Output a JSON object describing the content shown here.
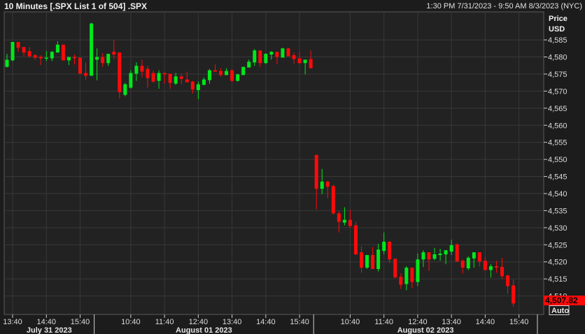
{
  "header": {
    "title": "10 Minutes [.SPX List 1 of 504] .SPX",
    "range": "1:30 PM 7/31/2023 - 9:50 AM 8/3/2023 (NYC)"
  },
  "colors": {
    "up": "#00e81a",
    "down": "#ff0a0a",
    "grid": "#383838",
    "background": "#222222"
  },
  "chart_data": {
    "type": "candlestick",
    "title": "10 Minutes [.SPX List 1 of 504] .SPX",
    "ylabel": "Price",
    "yunit": "USD",
    "ylim": [
      4504.6,
      4593.2
    ],
    "yticks": [
      4510,
      4515,
      4520,
      4525,
      4530,
      4535,
      4540,
      4545,
      4550,
      4555,
      4560,
      4565,
      4570,
      4575,
      4580,
      4585
    ],
    "ytick_labels": [
      "4,510",
      "4,515",
      "4,520",
      "4,525",
      "4,530",
      "4,535",
      "4,540",
      "4,545",
      "4,550",
      "4,555",
      "4,560",
      "4,565",
      "4,570",
      "4,575",
      "4,580",
      "4,585"
    ],
    "last_price_label": "4,507.82",
    "auto_label": "Auto",
    "xticks": [
      {
        "i": 2,
        "label": "13:40"
      },
      {
        "i": 8,
        "label": "14:40"
      },
      {
        "i": 14,
        "label": "15:40"
      },
      {
        "i": 23,
        "label": "10:40"
      },
      {
        "i": 29,
        "label": "11:40"
      },
      {
        "i": 35,
        "label": "12:40"
      },
      {
        "i": 41,
        "label": "13:40"
      },
      {
        "i": 47,
        "label": "14:40"
      },
      {
        "i": 53,
        "label": "15:40"
      },
      {
        "i": 62,
        "label": "10:40"
      },
      {
        "i": 68,
        "label": "11:40"
      },
      {
        "i": 74,
        "label": "12:40"
      },
      {
        "i": 80,
        "label": "13:40"
      },
      {
        "i": 86,
        "label": "14:40"
      },
      {
        "i": 92,
        "label": "15:40"
      }
    ],
    "days": [
      {
        "label": "July 31 2023",
        "from": 1,
        "to": 16
      },
      {
        "label": "August 01 2023",
        "from": 17,
        "to": 55
      },
      {
        "label": "August 02 2023",
        "from": 56,
        "to": 95
      }
    ],
    "grid": true,
    "ohlc": [
      [
        4577.1,
        4580.9,
        4576.9,
        4579.2
      ],
      [
        4579.0,
        4584.4,
        4578.8,
        4584.4
      ],
      [
        4584.4,
        4584.4,
        4581.5,
        4582.7
      ],
      [
        4582.9,
        4582.9,
        4580.2,
        4581.3
      ],
      [
        4581.7,
        4582.9,
        4579.8,
        4580.2
      ],
      [
        4580.5,
        4580.9,
        4579.2,
        4579.8
      ],
      [
        4580.0,
        4580.5,
        4577.6,
        4579.6
      ],
      [
        4579.6,
        4581.7,
        4578.8,
        4579.8
      ],
      [
        4579.6,
        4581.7,
        4578.8,
        4581.5
      ],
      [
        4581.3,
        4584.6,
        4581.3,
        4583.6
      ],
      [
        4583.6,
        4583.6,
        4579.0,
        4579.0
      ],
      [
        4579.0,
        4580.0,
        4577.6,
        4580.0
      ],
      [
        4580.0,
        4580.7,
        4577.8,
        4579.6
      ],
      [
        4579.8,
        4579.8,
        4575.1,
        4575.1
      ],
      [
        4575.3,
        4578.4,
        4573.2,
        4574.5
      ],
      [
        4574.5,
        4590.0,
        4574.5,
        4589.8
      ],
      [
        4579.2,
        4582.5,
        4573.2,
        4580.0
      ],
      [
        4580.0,
        4581.1,
        4577.1,
        4578.2
      ],
      [
        4578.2,
        4580.9,
        4577.4,
        4580.9
      ],
      [
        4581.5,
        4585.0,
        4579.4,
        4580.7
      ],
      [
        4581.3,
        4581.3,
        4567.9,
        4569.7
      ],
      [
        4568.9,
        4572.4,
        4568.5,
        4572.0
      ],
      [
        4571.0,
        4576.1,
        4570.7,
        4575.3
      ],
      [
        4575.1,
        4578.4,
        4573.0,
        4577.4
      ],
      [
        4577.4,
        4579.2,
        4574.0,
        4575.7
      ],
      [
        4576.5,
        4577.4,
        4571.0,
        4573.8
      ],
      [
        4575.3,
        4576.1,
        4572.4,
        4572.8
      ],
      [
        4573.0,
        4576.1,
        4570.7,
        4575.3
      ],
      [
        4575.3,
        4575.3,
        4572.2,
        4574.9
      ],
      [
        4575.1,
        4575.1,
        4570.7,
        4572.4
      ],
      [
        4572.2,
        4575.3,
        4571.8,
        4574.3
      ],
      [
        4574.3,
        4575.1,
        4572.0,
        4573.6
      ],
      [
        4573.4,
        4575.7,
        4572.6,
        4572.6
      ],
      [
        4572.8,
        4573.0,
        4569.3,
        4570.5
      ],
      [
        4570.3,
        4572.8,
        4567.6,
        4572.0
      ],
      [
        4571.8,
        4574.0,
        4571.8,
        4573.4
      ],
      [
        4573.2,
        4576.5,
        4572.2,
        4576.1
      ],
      [
        4576.1,
        4577.8,
        4575.7,
        4575.7
      ],
      [
        4575.9,
        4576.7,
        4574.3,
        4574.7
      ],
      [
        4574.7,
        4576.7,
        4574.7,
        4575.9
      ],
      [
        4576.1,
        4576.3,
        4572.6,
        4573.0
      ],
      [
        4573.0,
        4575.1,
        4572.8,
        4574.9
      ],
      [
        4574.7,
        4577.1,
        4574.7,
        4577.1
      ],
      [
        4576.9,
        4579.2,
        4576.9,
        4578.6
      ],
      [
        4578.4,
        4582.3,
        4577.4,
        4581.9
      ],
      [
        4581.9,
        4581.9,
        4577.1,
        4578.2
      ],
      [
        4578.2,
        4581.1,
        4578.0,
        4580.9
      ],
      [
        4580.7,
        4581.7,
        4579.2,
        4581.5
      ],
      [
        4581.5,
        4581.5,
        4577.8,
        4580.0
      ],
      [
        4579.8,
        4582.7,
        4579.8,
        4582.5
      ],
      [
        4582.5,
        4582.7,
        4580.2,
        4580.2
      ],
      [
        4580.5,
        4581.3,
        4578.0,
        4579.4
      ],
      [
        4579.6,
        4581.5,
        4577.8,
        4578.2
      ],
      [
        4578.2,
        4579.2,
        4574.9,
        4579.2
      ],
      [
        4579.4,
        4581.9,
        4576.7,
        4576.7
      ],
      [
        4551.3,
        4551.3,
        4535.4,
        4541.4
      ],
      [
        4541.4,
        4547.2,
        4539.8,
        4543.5
      ],
      [
        4543.5,
        4543.7,
        4538.7,
        4542.0
      ],
      [
        4542.2,
        4542.6,
        4533.8,
        4534.2
      ],
      [
        4534.2,
        4534.8,
        4528.6,
        4531.7
      ],
      [
        4531.5,
        4536.0,
        4530.7,
        4532.3
      ],
      [
        4532.3,
        4535.2,
        4530.0,
        4530.5
      ],
      [
        4530.7,
        4531.7,
        4522.0,
        4522.2
      ],
      [
        4522.8,
        4524.5,
        4516.8,
        4518.3
      ],
      [
        4518.3,
        4522.0,
        4517.9,
        4522.0
      ],
      [
        4522.0,
        4524.3,
        4517.9,
        4517.9
      ],
      [
        4517.9,
        4525.3,
        4517.2,
        4523.6
      ],
      [
        4523.2,
        4528.6,
        4522.2,
        4525.9
      ],
      [
        4525.9,
        4526.1,
        4519.7,
        4520.7
      ],
      [
        4520.9,
        4520.9,
        4515.4,
        4515.4
      ],
      [
        4515.6,
        4516.6,
        4512.1,
        4513.3
      ],
      [
        4513.5,
        4518.7,
        4511.7,
        4518.3
      ],
      [
        4518.3,
        4518.3,
        4512.3,
        4514.1
      ],
      [
        4514.1,
        4522.4,
        4512.9,
        4520.7
      ],
      [
        4520.7,
        4523.4,
        4518.5,
        4522.8
      ],
      [
        4522.8,
        4522.8,
        4517.4,
        4520.7
      ],
      [
        4520.9,
        4524.1,
        4520.5,
        4522.2
      ],
      [
        4522.0,
        4523.8,
        4520.3,
        4522.4
      ],
      [
        4522.2,
        4523.4,
        4519.3,
        4523.4
      ],
      [
        4523.0,
        4526.5,
        4522.0,
        4524.9
      ],
      [
        4525.1,
        4525.5,
        4520.1,
        4520.1
      ],
      [
        4520.3,
        4520.7,
        4516.6,
        4518.3
      ],
      [
        4518.1,
        4521.6,
        4517.6,
        4521.2
      ],
      [
        4521.0,
        4522.8,
        4518.3,
        4522.8
      ],
      [
        4522.8,
        4522.8,
        4518.7,
        4520.1
      ],
      [
        4520.3,
        4521.4,
        4517.6,
        4517.6
      ],
      [
        4517.6,
        4519.3,
        4515.4,
        4518.7
      ],
      [
        4518.7,
        4520.3,
        4516.8,
        4518.3
      ],
      [
        4518.5,
        4521.2,
        4515.0,
        4515.8
      ],
      [
        4516.0,
        4516.2,
        4510.6,
        4512.9
      ],
      [
        4513.1,
        4514.8,
        4506.9,
        4507.82
      ]
    ]
  }
}
